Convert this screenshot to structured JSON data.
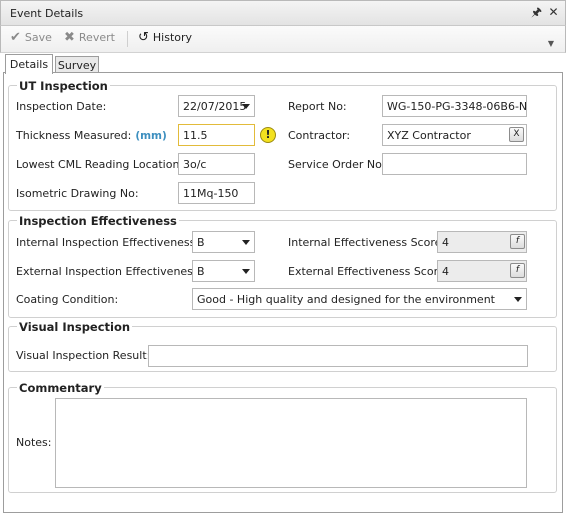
{
  "window": {
    "title": "Event Details"
  },
  "titlebar_icons": {
    "pin": "pin-icon",
    "close": "close-icon"
  },
  "toolbar": {
    "save_label": "Save",
    "revert_label": "Revert",
    "history_label": "History"
  },
  "tabs": [
    {
      "label": "Details",
      "active": true
    },
    {
      "label": "Survey",
      "active": false
    }
  ],
  "ut_inspection": {
    "legend": "UT Inspection",
    "inspection_date_label": "Inspection Date:",
    "inspection_date_value": "22/07/2015",
    "thickness_label": "Thickness Measured:",
    "thickness_unit": "(mm)",
    "thickness_value": "11.5",
    "lowest_cml_label": "Lowest CML Reading Location:",
    "lowest_cml_value": "3o/c",
    "isometric_label": "Isometric Drawing No:",
    "isometric_value": "11Mq-150",
    "report_no_label": "Report No:",
    "report_no_value": "WG-150-PG-3348-06B6-N",
    "contractor_label": "Contractor:",
    "contractor_value": "XYZ Contractor",
    "contractor_clear": "X",
    "service_order_label": "Service Order No:",
    "service_order_value": ""
  },
  "effectiveness": {
    "legend": "Inspection Effectiveness",
    "internal_label": "Internal Inspection Effectiveness:",
    "internal_value": "B",
    "external_label": "External Inspection Effectiveness:",
    "external_value": "B",
    "internal_score_label": "Internal Effectiveness Score:",
    "internal_score_value": "4",
    "external_score_label": "External Effectiveness Score:",
    "external_score_value": "4",
    "formula_button": "f",
    "coating_label": "Coating Condition:",
    "coating_value": "Good - High quality and designed for the environment"
  },
  "visual": {
    "legend": "Visual Inspection",
    "result_label": "Visual Inspection Result:",
    "result_value": ""
  },
  "commentary": {
    "legend": "Commentary",
    "notes_label": "Notes:",
    "notes_value": ""
  },
  "warning_icon_glyph": "!"
}
